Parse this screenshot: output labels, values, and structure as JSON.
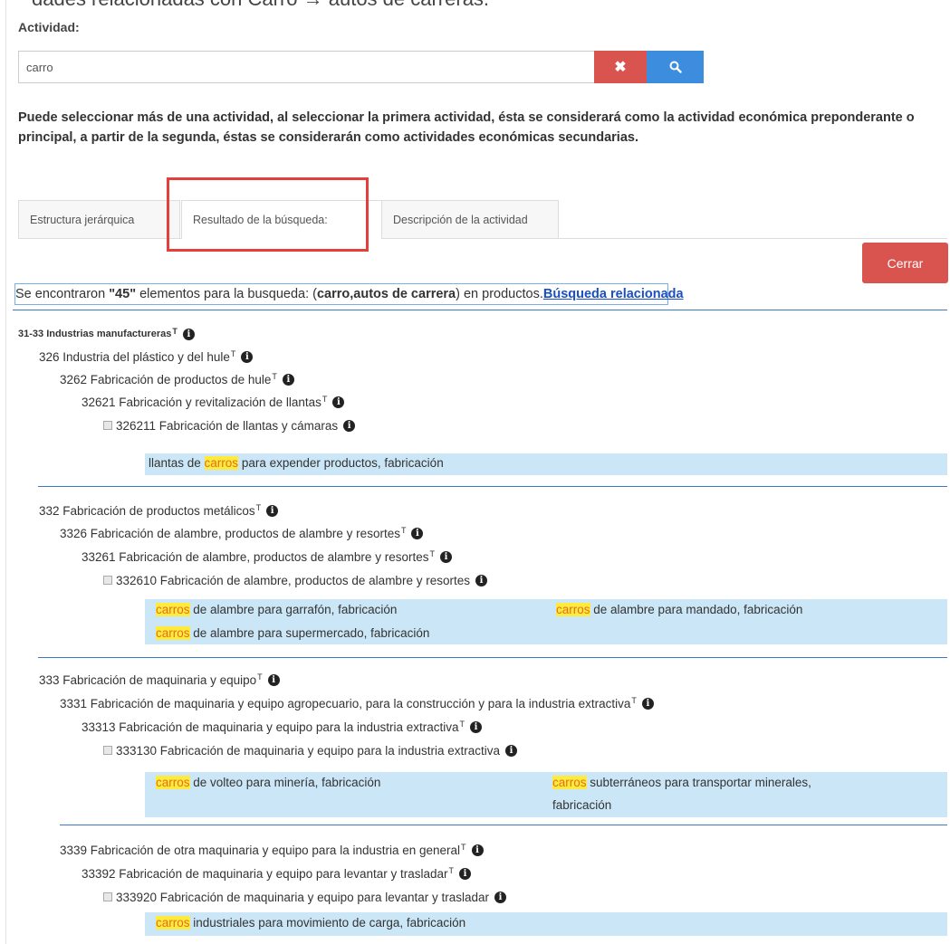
{
  "top_clipped_text": "dades relacionadas con Carro → autos de carreras.",
  "activity_label": "Actividad:",
  "search": {
    "value": "carro"
  },
  "icons": {
    "clear": "close-icon",
    "search": "search-icon",
    "info": "info-icon",
    "checkbox": "checkbox-icon"
  },
  "notice": "Puede seleccionar más de una actividad, al seleccionar la primera actividad, ésta se considerará como la actividad económica preponderante o principal, a partir de la segunda, éstas se considerarán como actividades económicas secundarias.",
  "tabs": [
    {
      "label": "Estructura jerárquica"
    },
    {
      "label": "Resultado de la búsqueda:"
    },
    {
      "label": "Descripción de la actividad"
    }
  ],
  "close_button": "Cerrar",
  "summary": {
    "prefix": "Se encontraron ",
    "count": "\"45\"",
    "middle": " elementos para la busqueda: (",
    "terms": "carro,autos de carrera",
    "suffix": ") en productos.",
    "related_link": "Búsqueda relacionada"
  },
  "highlight_word": "carros",
  "tree": {
    "root": "31-33 Industrias manufactureras",
    "sup": "T",
    "g1": {
      "l1": "326 Industria del plástico y del hule",
      "l2": "3262 Fabricación de productos de hule",
      "l3": "32621 Fabricación y revitalización de llantas",
      "l4": "326211 Fabricación de llantas y cámaras",
      "p1_pre": "llantas de ",
      "p1_post": " para expender productos, fabricación"
    },
    "g2": {
      "l1": "332 Fabricación de productos metálicos",
      "l2": "3326 Fabricación de alambre, productos de alambre y resortes",
      "l3": "33261 Fabricación de alambre, productos de alambre y resortes",
      "l4": "332610 Fabricación de alambre, productos de alambre y resortes",
      "p1_post": " de alambre para garrafón, fabricación",
      "p2_post": " de alambre para mandado, fabricación",
      "p3_post": " de alambre para supermercado, fabricación"
    },
    "g3": {
      "l1": "333 Fabricación de maquinaria y equipo",
      "l2": "3331 Fabricación de maquinaria y equipo agropecuario, para la construcción y para la industria extractiva",
      "l3": "33313 Fabricación de maquinaria y equipo para la industria extractiva",
      "l4": "333130 Fabricación de maquinaria y equipo para la industria extractiva",
      "p1_post": " de volteo para minería, fabricación",
      "p2_post": " subterráneos para transportar minerales,",
      "p2_line2": "fabricación"
    },
    "g4": {
      "l2": "3339 Fabricación de otra maquinaria y equipo para la industria en general",
      "l3": "33392 Fabricación de maquinaria y equipo para levantar y trasladar",
      "l4": "333920 Fabricación de maquinaria y equipo para levantar y trasladar",
      "p1_post": " industriales para movimiento de carga, fabricación"
    }
  }
}
